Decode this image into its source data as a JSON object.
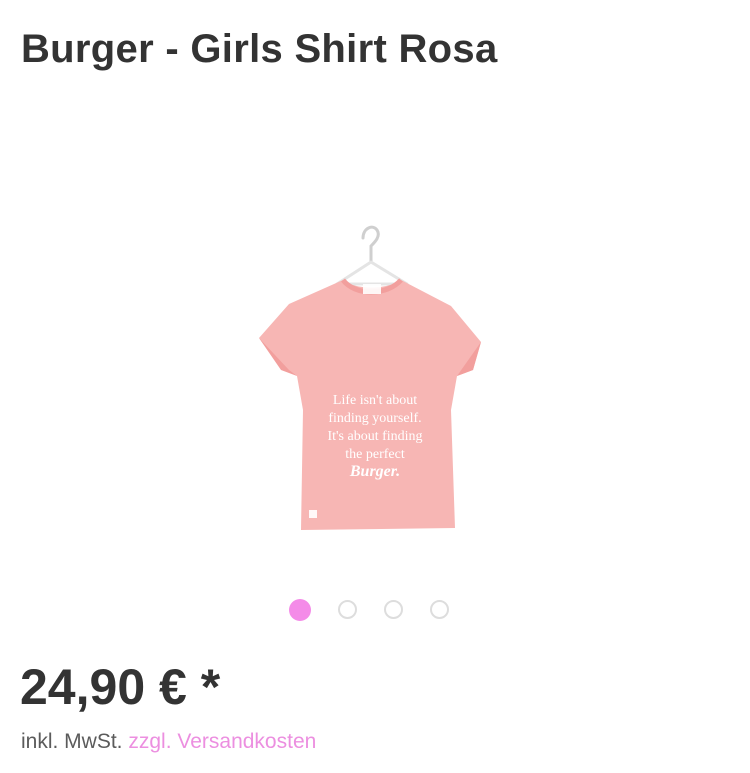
{
  "product": {
    "title": "Burger - Girls Shirt Rosa",
    "price": "24,90 € *",
    "tax_prefix": "inkl. MwSt.",
    "shipping_link": "zzgl. Versandkosten",
    "image": {
      "shirt_text_lines": [
        "Life isn't about",
        "finding yourself.",
        "It's about finding",
        "the perfect",
        "Burger."
      ],
      "shirt_color": "#f7b6b4",
      "icon": "tshirt-on-hanger"
    }
  },
  "gallery": {
    "dot_count": 4,
    "active_index": 0
  },
  "colors": {
    "accent": "#f48be8",
    "link": "#ec8fe0",
    "text": "#333333"
  }
}
